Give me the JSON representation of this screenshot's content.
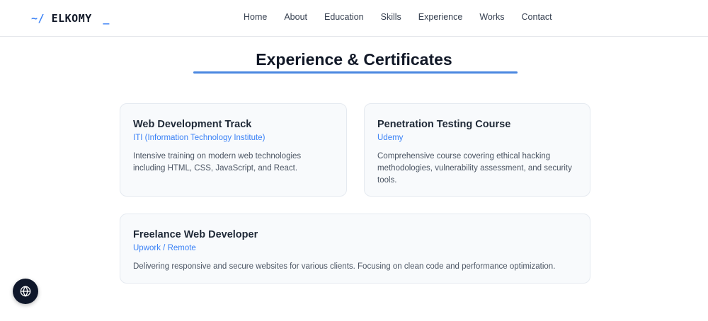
{
  "brand": {
    "prompt": "~/",
    "name": "ELKOMY",
    "cursor": "_"
  },
  "nav": {
    "items": [
      {
        "label": "Home"
      },
      {
        "label": "About"
      },
      {
        "label": "Education"
      },
      {
        "label": "Skills"
      },
      {
        "label": "Experience"
      },
      {
        "label": "Works"
      },
      {
        "label": "Contact"
      }
    ]
  },
  "section": {
    "title": "Experience & Certificates",
    "cards": [
      {
        "title": "Web Development Track",
        "org": "ITI (Information Technology Institute)",
        "description": "Intensive training on modern web technologies including HTML, CSS, JavaScript, and React."
      },
      {
        "title": "Penetration Testing Course",
        "org": "Udemy",
        "description": "Comprehensive course covering ethical hacking methodologies, vulnerability assessment, and security tools."
      },
      {
        "title": "Freelance Web Developer",
        "org": "Upwork / Remote",
        "description": "Delivering responsive and secure websites for various clients. Focusing on clean code and performance optimization."
      }
    ]
  },
  "floating": {
    "icon": "globe-icon"
  },
  "colors": {
    "accent": "#3b82f6",
    "underline": "#4a87e0",
    "card_bg": "#f8fafc",
    "fab_bg": "#0f172a"
  }
}
